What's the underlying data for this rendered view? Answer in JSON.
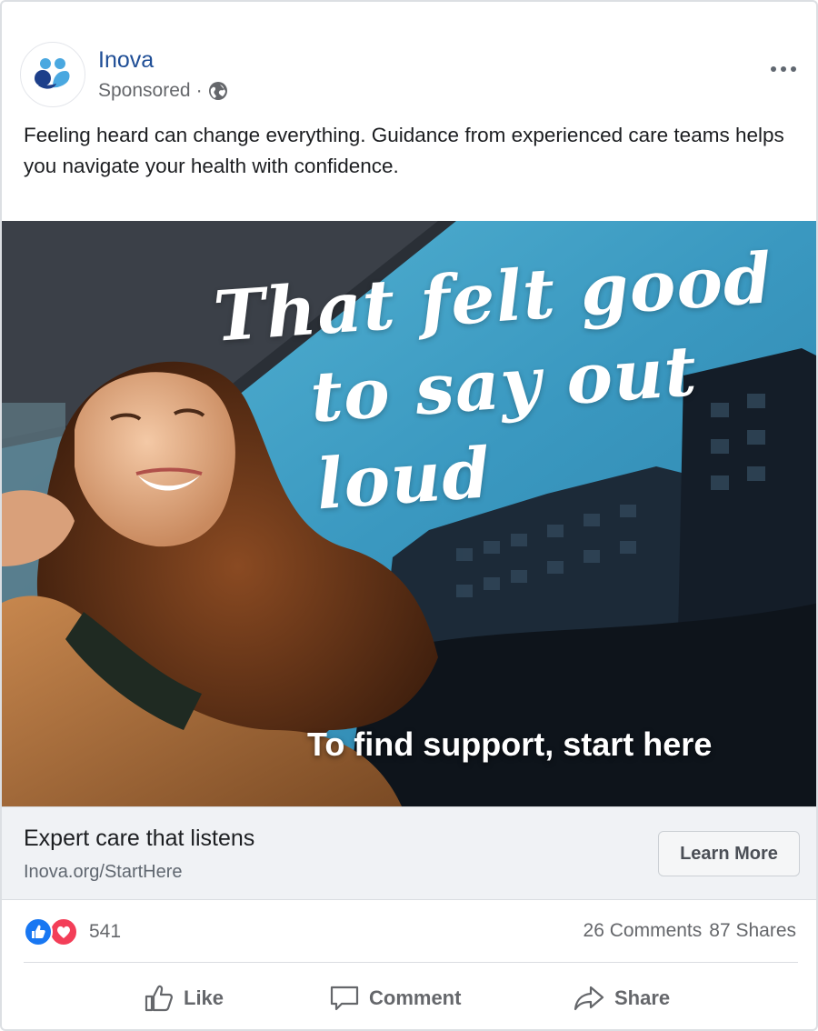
{
  "post": {
    "page_name": "Inova",
    "sponsored_label": "Sponsored",
    "separator": "·",
    "body_text": "Feeling heard can change everything. Guidance from experienced care teams helps you navigate your health with confidence."
  },
  "creative": {
    "headline_line1": "That felt good",
    "headline_line2": "to say out loud",
    "overlay_text": "To find support, start here"
  },
  "link": {
    "title": "Expert care that listens",
    "url": "Inova.org/StartHere",
    "cta_label": "Learn More"
  },
  "engagement": {
    "reaction_count": "541",
    "comments": "26 Comments",
    "shares": "87 Shares"
  },
  "actions": {
    "like_label": "Like",
    "comment_label": "Comment",
    "share_label": "Share"
  },
  "colors": {
    "brand_name": "#1f4e96",
    "logo_dark": "#1d3f8a",
    "logo_light": "#4aa8e0",
    "like_blue": "#1877f2",
    "love_red": "#f33e58"
  },
  "icons": {
    "more": "more-options-icon",
    "audience": "globe-icon",
    "like": "thumbs-up-icon",
    "comment": "comment-bubble-icon",
    "share": "share-arrow-icon"
  }
}
